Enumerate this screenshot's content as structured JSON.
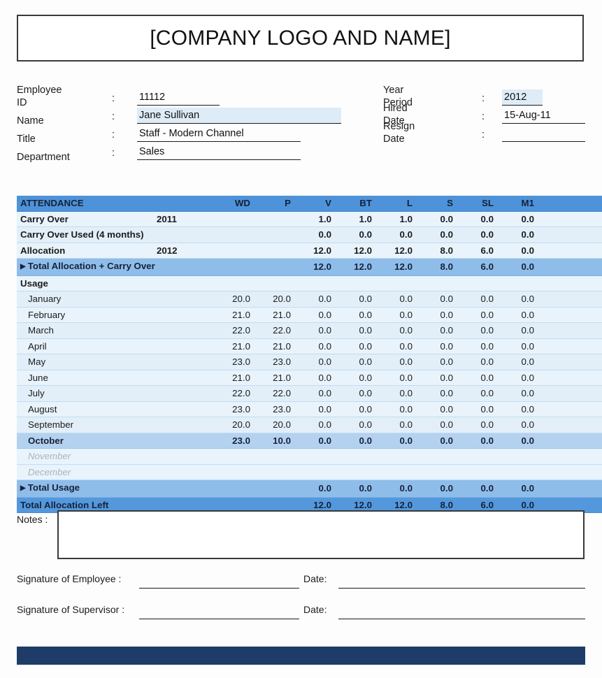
{
  "header": {
    "logo_text": "[COMPANY LOGO AND NAME]"
  },
  "info": {
    "colon": ":",
    "left": [
      {
        "label": "Employee ID",
        "value": "11112",
        "highlight": false
      },
      {
        "label": "Name",
        "value": "Jane Sullivan",
        "highlight": true
      },
      {
        "label": "Title",
        "value": "Staff - Modern Channel",
        "highlight": false
      },
      {
        "label": "Department",
        "value": "Sales",
        "highlight": false
      }
    ],
    "right": [
      {
        "label": "Year Period",
        "value": "2012",
        "highlight": true
      },
      {
        "label": "Hired Date",
        "value": "15-Aug-11",
        "highlight": false
      },
      {
        "label": "Resign Date",
        "value": "",
        "highlight": false
      }
    ]
  },
  "table": {
    "title": "ATTENDANCE",
    "columns": [
      "WD",
      "P",
      "V",
      "BT",
      "L",
      "S",
      "SL",
      "M1"
    ],
    "rows": [
      {
        "label": "Carry Over",
        "year": "2011",
        "values": [
          "",
          "",
          "1.0",
          "1.0",
          "1.0",
          "0.0",
          "0.0",
          "0.0"
        ],
        "style": "row-lite row-bold"
      },
      {
        "label": "Carry Over Used (4 months)",
        "year": "",
        "values": [
          "",
          "",
          "0.0",
          "0.0",
          "0.0",
          "0.0",
          "0.0",
          "0.0"
        ],
        "style": "row-lite2 row-bold"
      },
      {
        "label": "Allocation",
        "year": "2012",
        "values": [
          "",
          "",
          "12.0",
          "12.0",
          "12.0",
          "8.0",
          "6.0",
          "0.0"
        ],
        "style": "row-lite row-bold"
      },
      {
        "label": "Total Allocation + Carry Over Used",
        "year": "",
        "values": [
          "",
          "",
          "12.0",
          "12.0",
          "12.0",
          "8.0",
          "6.0",
          "0.0"
        ],
        "style": "row-mid",
        "triangle": true
      },
      {
        "label": "Usage",
        "year": "",
        "values": [
          "",
          "",
          "",
          "",
          "",
          "",
          "",
          ""
        ],
        "style": "row-lite row-bold"
      },
      {
        "label": "January",
        "year": "",
        "values": [
          "20.0",
          "20.0",
          "0.0",
          "0.0",
          "0.0",
          "0.0",
          "0.0",
          "0.0"
        ],
        "style": "row-lite2",
        "indent": true
      },
      {
        "label": "February",
        "year": "",
        "values": [
          "21.0",
          "21.0",
          "0.0",
          "0.0",
          "0.0",
          "0.0",
          "0.0",
          "0.0"
        ],
        "style": "row-lite",
        "indent": true
      },
      {
        "label": "March",
        "year": "",
        "values": [
          "22.0",
          "22.0",
          "0.0",
          "0.0",
          "0.0",
          "0.0",
          "0.0",
          "0.0"
        ],
        "style": "row-lite2",
        "indent": true
      },
      {
        "label": "April",
        "year": "",
        "values": [
          "21.0",
          "21.0",
          "0.0",
          "0.0",
          "0.0",
          "0.0",
          "0.0",
          "0.0"
        ],
        "style": "row-lite",
        "indent": true
      },
      {
        "label": "May",
        "year": "",
        "values": [
          "23.0",
          "23.0",
          "0.0",
          "0.0",
          "0.0",
          "0.0",
          "0.0",
          "0.0"
        ],
        "style": "row-lite2",
        "indent": true
      },
      {
        "label": "June",
        "year": "",
        "values": [
          "21.0",
          "21.0",
          "0.0",
          "0.0",
          "0.0",
          "0.0",
          "0.0",
          "0.0"
        ],
        "style": "row-lite",
        "indent": true
      },
      {
        "label": "July",
        "year": "",
        "values": [
          "22.0",
          "22.0",
          "0.0",
          "0.0",
          "0.0",
          "0.0",
          "0.0",
          "0.0"
        ],
        "style": "row-lite2",
        "indent": true
      },
      {
        "label": "August",
        "year": "",
        "values": [
          "23.0",
          "23.0",
          "0.0",
          "0.0",
          "0.0",
          "0.0",
          "0.0",
          "0.0"
        ],
        "style": "row-lite",
        "indent": true
      },
      {
        "label": "September",
        "year": "",
        "values": [
          "20.0",
          "20.0",
          "0.0",
          "0.0",
          "0.0",
          "0.0",
          "0.0",
          "0.0"
        ],
        "style": "row-lite2",
        "indent": true
      },
      {
        "label": "October",
        "year": "",
        "values": [
          "23.0",
          "10.0",
          "0.0",
          "0.0",
          "0.0",
          "0.0",
          "0.0",
          "0.0"
        ],
        "style": "row-month-hl",
        "indent": true
      },
      {
        "label": "November",
        "year": "",
        "values": [
          "",
          "",
          "",
          "",
          "",
          "",
          "",
          ""
        ],
        "style": "row-ghost",
        "indent": true
      },
      {
        "label": "December",
        "year": "",
        "values": [
          "",
          "",
          "",
          "",
          "",
          "",
          "",
          ""
        ],
        "style": "row-ghost",
        "indent": true
      },
      {
        "label": "Total Usage",
        "year": "",
        "values": [
          "",
          "",
          "0.0",
          "0.0",
          "0.0",
          "0.0",
          "0.0",
          "0.0"
        ],
        "style": "row-mid",
        "triangle": true
      },
      {
        "label": "Total Allocation Left",
        "year": "",
        "values": [
          "",
          "",
          "12.0",
          "12.0",
          "12.0",
          "8.0",
          "6.0",
          "0.0"
        ],
        "style": "row-dark"
      }
    ]
  },
  "notes": {
    "label": "Notes :",
    "value": ""
  },
  "signatures": {
    "employee_label": "Signature of Employee :",
    "employee_value": "",
    "employee_date_label": "Date:",
    "employee_date_value": "",
    "supervisor_label": "Signature of Supervisor :",
    "supervisor_value": "",
    "supervisor_date_label": "Date:",
    "supervisor_date_value": ""
  },
  "colors": {
    "header_blue": "#4e93d9",
    "mid_blue": "#8fbdea",
    "dark_blue": "#5398dc",
    "row_light": "#e8f3fb",
    "row_light_alt": "#e2eff9",
    "highlight": "#deecf7",
    "footer_navy": "#1e3c67"
  }
}
